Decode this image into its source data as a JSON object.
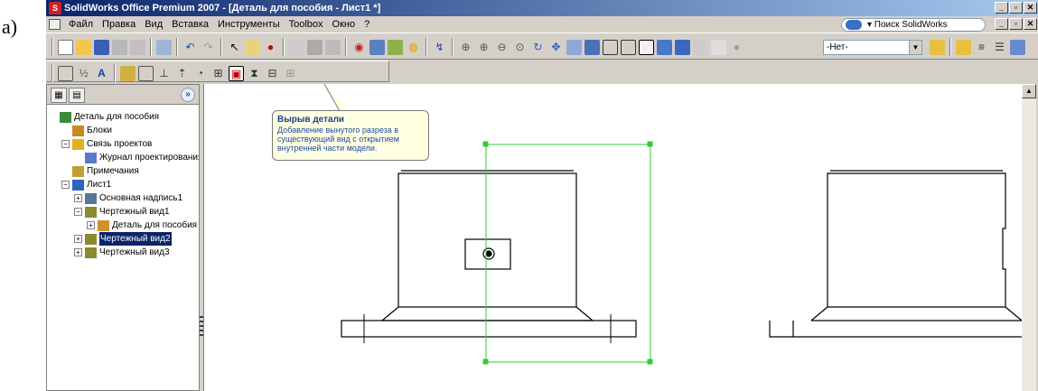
{
  "figure_label": "а)",
  "window": {
    "title": "SolidWorks Office Premium 2007 - [Деталь для пособия - Лист1 *]",
    "app_icon": "solidworks-logo-icon",
    "title_buttons": [
      "_",
      "▫",
      "✕"
    ],
    "doc_buttons": [
      "_",
      "▫",
      "✕"
    ]
  },
  "menu": {
    "items": [
      "Файл",
      "Правка",
      "Вид",
      "Вставка",
      "Инструменты",
      "Toolbox",
      "Окно",
      "?"
    ],
    "search_placeholder": "▾ Поиск SolidWorks"
  },
  "toolbar": {
    "layer_combo_value": "-Нет-",
    "combo_arrow": "▼",
    "scroll_up_arrow": "▲"
  },
  "feature_tree": {
    "expand_button": "»",
    "items": [
      {
        "label": "Деталь для пособия",
        "icon": "drawing-doc-icon",
        "level": 0,
        "toggle": ""
      },
      {
        "label": "Блоки",
        "icon": "blocks-icon",
        "level": 1,
        "toggle": ""
      },
      {
        "label": "Связь проектов",
        "icon": "design-binder-icon",
        "level": 1,
        "toggle": "−"
      },
      {
        "label": "Журнал проектирования",
        "icon": "journal-icon",
        "level": 2,
        "toggle": ""
      },
      {
        "label": "Примечания",
        "icon": "annotations-icon",
        "level": 1,
        "toggle": ""
      },
      {
        "label": "Лист1",
        "icon": "sheet-icon",
        "level": 1,
        "toggle": "−"
      },
      {
        "label": "Основная надпись1",
        "icon": "sheet-format-icon",
        "level": 2,
        "toggle": "+"
      },
      {
        "label": "Чертежный вид1",
        "icon": "drawing-view-icon",
        "level": 2,
        "toggle": "−"
      },
      {
        "label": "Деталь для пособия",
        "icon": "part-icon",
        "level": 3,
        "toggle": "+"
      },
      {
        "label": "Чертежный вид2",
        "icon": "drawing-view-icon",
        "level": 2,
        "toggle": "+",
        "selected": true
      },
      {
        "label": "Чертежный вид3",
        "icon": "drawing-view-icon",
        "level": 2,
        "toggle": "+"
      }
    ]
  },
  "tooltip": {
    "title": "Вырыв детали",
    "body": "Добавление вынутого разреза в существующий вид с открытием внутренней части модели."
  },
  "colors": {
    "selection_box": "#33cc33",
    "title_gradient_start": "#0a246a",
    "tooltip_bg": "#ffffe1"
  }
}
